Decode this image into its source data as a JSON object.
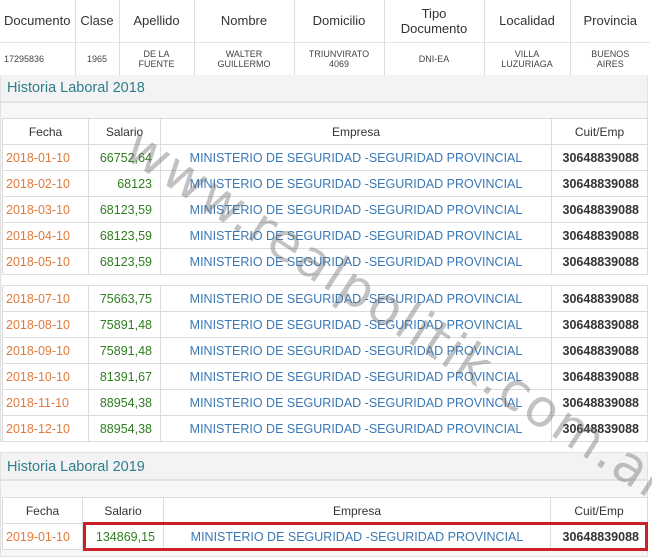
{
  "person": {
    "headers": [
      "Documento",
      "Clase",
      "Apellido",
      "Nombre",
      "Domicilio",
      "Tipo Documento",
      "Localidad",
      "Provincia"
    ],
    "tipo_documento_lines": [
      "Tipo",
      "Documento"
    ],
    "documento": "17295836",
    "clase": "1965",
    "apellido_lines": [
      "DE LA",
      "FUENTE"
    ],
    "nombre_lines": [
      "WALTER",
      "GUILLERMO"
    ],
    "domicilio_lines": [
      "TRIUNVIRATO",
      "4069"
    ],
    "tipo_documento": "DNI-EA",
    "localidad_lines": [
      "VILLA",
      "LUZURIAGA"
    ],
    "provincia_lines": [
      "BUENOS",
      "AIRES"
    ]
  },
  "sections": [
    {
      "title": "Historia Laboral 2018",
      "columns": [
        "Fecha",
        "Salario",
        "Empresa",
        "Cuit/Emp"
      ],
      "rows": [
        {
          "fecha": "2018-01-10",
          "salario": "66752,64",
          "empresa": "MINISTERIO DE SEGURIDAD -SEGURIDAD PROVINCIAL",
          "cuit": "30648839088"
        },
        {
          "fecha": "2018-02-10",
          "salario": "68123",
          "empresa": "MINISTERIO DE SEGURIDAD -SEGURIDAD PROVINCIAL",
          "cuit": "30648839088"
        },
        {
          "fecha": "2018-03-10",
          "salario": "68123,59",
          "empresa": "MINISTERIO DE SEGURIDAD -SEGURIDAD PROVINCIAL",
          "cuit": "30648839088"
        },
        {
          "fecha": "2018-04-10",
          "salario": "68123,59",
          "empresa": "MINISTERIO DE SEGURIDAD -SEGURIDAD PROVINCIAL",
          "cuit": "30648839088"
        },
        {
          "fecha": "2018-05-10",
          "salario": "68123,59",
          "empresa": "MINISTERIO DE SEGURIDAD -SEGURIDAD PROVINCIAL",
          "cuit": "30648839088"
        },
        {
          "fecha": "2018-07-10",
          "salario": "75663,75",
          "empresa": "MINISTERIO DE SEGURIDAD -SEGURIDAD PROVINCIAL",
          "cuit": "30648839088"
        },
        {
          "fecha": "2018-08-10",
          "salario": "75891,48",
          "empresa": "MINISTERIO DE SEGURIDAD -SEGURIDAD PROVINCIAL",
          "cuit": "30648839088"
        },
        {
          "fecha": "2018-09-10",
          "salario": "75891,48",
          "empresa": "MINISTERIO DE SEGURIDAD -SEGURIDAD PROVINCIAL",
          "cuit": "30648839088"
        },
        {
          "fecha": "2018-10-10",
          "salario": "81391,67",
          "empresa": "MINISTERIO DE SEGURIDAD -SEGURIDAD PROVINCIAL",
          "cuit": "30648839088"
        },
        {
          "fecha": "2018-11-10",
          "salario": "88954,38",
          "empresa": "MINISTERIO DE SEGURIDAD -SEGURIDAD PROVINCIAL",
          "cuit": "30648839088"
        },
        {
          "fecha": "2018-12-10",
          "salario": "88954,38",
          "empresa": "MINISTERIO DE SEGURIDAD -SEGURIDAD PROVINCIAL",
          "cuit": "30648839088"
        }
      ]
    },
    {
      "title": "Historia Laboral 2019",
      "columns": [
        "Fecha",
        "Salario",
        "Empresa",
        "Cuit/Emp"
      ],
      "rows": [
        {
          "fecha": "2019-01-10",
          "salario": "134869,15",
          "empresa": "MINISTERIO DE SEGURIDAD -SEGURIDAD PROVINCIAL",
          "cuit": "30648839088"
        }
      ]
    }
  ],
  "watermark": "www.realpolitik.com.ar",
  "colors": {
    "fecha": "#e07b3c",
    "salario": "#2e7d1f",
    "empresa": "#3a78b5",
    "section_title": "#2f7d8d",
    "highlight": "#cc1f26"
  }
}
